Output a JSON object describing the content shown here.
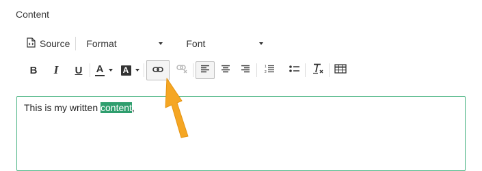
{
  "field": {
    "label": "Content"
  },
  "toolbar": {
    "source_label": "Source",
    "format_label": "Format",
    "font_label": "Font",
    "bold_glyph": "B",
    "italic_glyph": "I",
    "underline_glyph": "U",
    "text_color_glyph": "A",
    "bg_color_glyph": "A",
    "link_active": true,
    "unlink_disabled": true
  },
  "editor": {
    "text_before": "This is my written ",
    "selected_text": "content",
    "text_after": ","
  },
  "colors": {
    "editor_border": "#52b788",
    "selection_bg": "#2f9e6e",
    "arrow": "#f5a623"
  }
}
